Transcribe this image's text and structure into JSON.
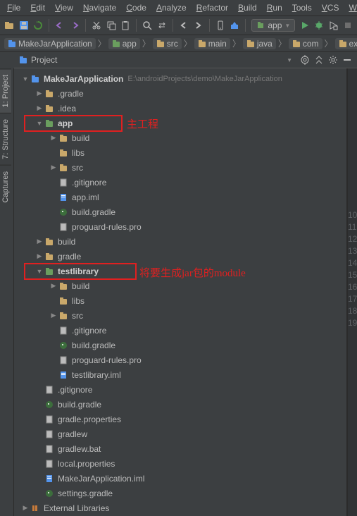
{
  "menu": [
    "File",
    "Edit",
    "View",
    "Navigate",
    "Code",
    "Analyze",
    "Refactor",
    "Build",
    "Run",
    "Tools",
    "VCS",
    "Wi"
  ],
  "run_config": {
    "label": "app"
  },
  "breadcrumb": [
    {
      "icon": "project",
      "label": "MakeJarApplication"
    },
    {
      "icon": "module",
      "label": "app"
    },
    {
      "icon": "folder",
      "label": "src"
    },
    {
      "icon": "folder",
      "label": "main"
    },
    {
      "icon": "folder",
      "label": "java"
    },
    {
      "icon": "folder",
      "label": "com"
    },
    {
      "icon": "folder",
      "label": "example"
    }
  ],
  "panel": {
    "title": "Project"
  },
  "sidebar_tabs": [
    {
      "label": "1: Project",
      "active": true
    },
    {
      "label": "7: Structure",
      "active": false
    },
    {
      "label": "Captures",
      "active": false
    }
  ],
  "annotations": {
    "main_project": "主工程",
    "jar_module": "将要生成jar包的module"
  },
  "gutter_lines": [
    "10",
    "11",
    "12",
    "13",
    "14",
    "15",
    "16",
    "17",
    "18",
    "19"
  ],
  "tree": [
    {
      "d": 0,
      "a": "open",
      "i": "project",
      "l": "MakeJarApplication",
      "bold": true,
      "path": "E:\\androidProjects\\demo\\MakeJarApplication"
    },
    {
      "d": 1,
      "a": "closed",
      "i": "folder",
      "l": ".gradle"
    },
    {
      "d": 1,
      "a": "closed",
      "i": "folder",
      "l": ".idea"
    },
    {
      "d": 1,
      "a": "open",
      "i": "module",
      "l": "app",
      "bold": true
    },
    {
      "d": 2,
      "a": "closed",
      "i": "folder",
      "l": "build"
    },
    {
      "d": 2,
      "a": "none",
      "i": "folder",
      "l": "libs"
    },
    {
      "d": 2,
      "a": "closed",
      "i": "folder",
      "l": "src"
    },
    {
      "d": 2,
      "a": "none",
      "i": "file",
      "l": ".gitignore"
    },
    {
      "d": 2,
      "a": "none",
      "i": "iml",
      "l": "app.iml"
    },
    {
      "d": 2,
      "a": "none",
      "i": "gradle",
      "l": "build.gradle"
    },
    {
      "d": 2,
      "a": "none",
      "i": "file",
      "l": "proguard-rules.pro"
    },
    {
      "d": 1,
      "a": "closed",
      "i": "folder",
      "l": "build"
    },
    {
      "d": 1,
      "a": "closed",
      "i": "folder",
      "l": "gradle"
    },
    {
      "d": 1,
      "a": "open",
      "i": "module",
      "l": "testlibrary",
      "bold": true
    },
    {
      "d": 2,
      "a": "closed",
      "i": "folder",
      "l": "build"
    },
    {
      "d": 2,
      "a": "none",
      "i": "folder",
      "l": "libs"
    },
    {
      "d": 2,
      "a": "closed",
      "i": "folder",
      "l": "src"
    },
    {
      "d": 2,
      "a": "none",
      "i": "file",
      "l": ".gitignore"
    },
    {
      "d": 2,
      "a": "none",
      "i": "gradle",
      "l": "build.gradle"
    },
    {
      "d": 2,
      "a": "none",
      "i": "file",
      "l": "proguard-rules.pro"
    },
    {
      "d": 2,
      "a": "none",
      "i": "iml",
      "l": "testlibrary.iml"
    },
    {
      "d": 1,
      "a": "none",
      "i": "file",
      "l": ".gitignore"
    },
    {
      "d": 1,
      "a": "none",
      "i": "gradle",
      "l": "build.gradle"
    },
    {
      "d": 1,
      "a": "none",
      "i": "file",
      "l": "gradle.properties"
    },
    {
      "d": 1,
      "a": "none",
      "i": "file",
      "l": "gradlew"
    },
    {
      "d": 1,
      "a": "none",
      "i": "file",
      "l": "gradlew.bat"
    },
    {
      "d": 1,
      "a": "none",
      "i": "file",
      "l": "local.properties"
    },
    {
      "d": 1,
      "a": "none",
      "i": "iml",
      "l": "MakeJarApplication.iml"
    },
    {
      "d": 1,
      "a": "none",
      "i": "gradle",
      "l": "settings.gradle"
    },
    {
      "d": 0,
      "a": "closed",
      "i": "lib",
      "l": "External Libraries"
    }
  ]
}
